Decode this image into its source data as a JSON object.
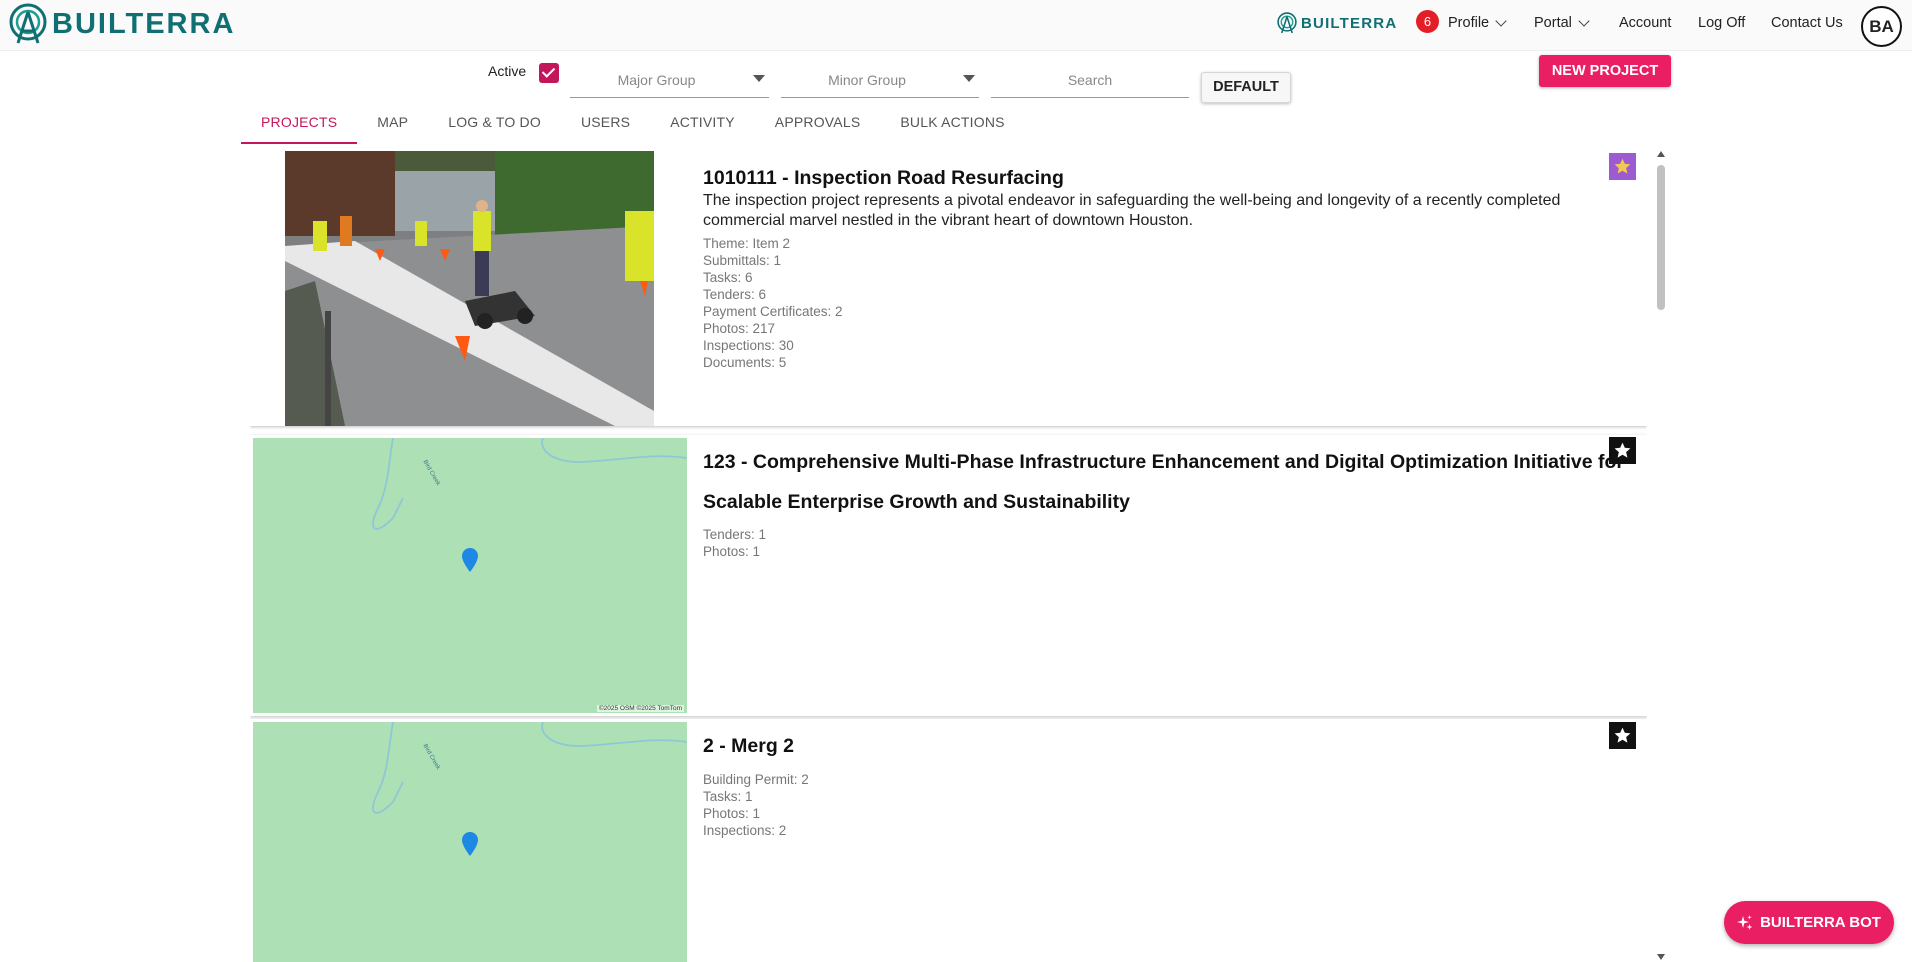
{
  "header": {
    "brand": "BUILTERRA",
    "brand_small": "BUILTERRA",
    "notification_count": "6",
    "nav": {
      "profile": "Profile",
      "portal": "Portal",
      "account": "Account",
      "logoff": "Log Off",
      "contact": "Contact Us"
    },
    "avatar_initials": "BA"
  },
  "filters": {
    "active_label": "Active",
    "active_checked": true,
    "major_group_placeholder": "Major Group",
    "minor_group_placeholder": "Minor Group",
    "search_placeholder": "Search",
    "default_button": "DEFAULT",
    "new_project_button": "NEW PROJECT"
  },
  "tabs": [
    {
      "label": "PROJECTS",
      "active": true
    },
    {
      "label": "MAP",
      "active": false
    },
    {
      "label": "LOG & TO DO",
      "active": false
    },
    {
      "label": "USERS",
      "active": false
    },
    {
      "label": "ACTIVITY",
      "active": false
    },
    {
      "label": "APPROVALS",
      "active": false
    },
    {
      "label": "BULK ACTIONS",
      "active": false
    }
  ],
  "projects": [
    {
      "title": "1010111 - Inspection Road Resurfacing",
      "description": "The inspection project represents a pivotal endeavor in safeguarding the well-being and longevity of a recently completed commercial marvel nestled in the vibrant heart of downtown Houston.",
      "thumbnail": "photo",
      "favorite": true,
      "stats": [
        "Theme: Item 2",
        "Submittals: 1",
        "Tasks: 6",
        "Tenders: 6",
        "Payment Certificates: 2",
        "Photos: 217",
        "Inspections: 30",
        "Documents: 5"
      ]
    },
    {
      "title": "123 - Comprehensive Multi-Phase Infrastructure Enhancement and Digital Optimization Initiative for Scalable Enterprise Growth and Sustainability",
      "thumbnail": "map",
      "map_attribution": "©2025 OSM ©2025 TomTom",
      "map_label": "Bird Creek",
      "favorite": false,
      "stats": [
        "Tenders: 1",
        "Photos: 1"
      ]
    },
    {
      "title": "2 - Merg 2",
      "thumbnail": "map",
      "map_label": "Bird Creek",
      "favorite": false,
      "stats": [
        "Building Permit: 2",
        "Tasks: 1",
        "Photos: 1",
        "Inspections: 2"
      ]
    }
  ],
  "bot_button": "BUILTERRA BOT",
  "colors": {
    "brand_teal": "#0f6f73",
    "accent_pink": "#e91e63",
    "tab_active": "#c2185b",
    "favorite_purple": "#9c5bd0",
    "map_green": "#aee0b5",
    "pin_blue": "#1e88e5"
  }
}
